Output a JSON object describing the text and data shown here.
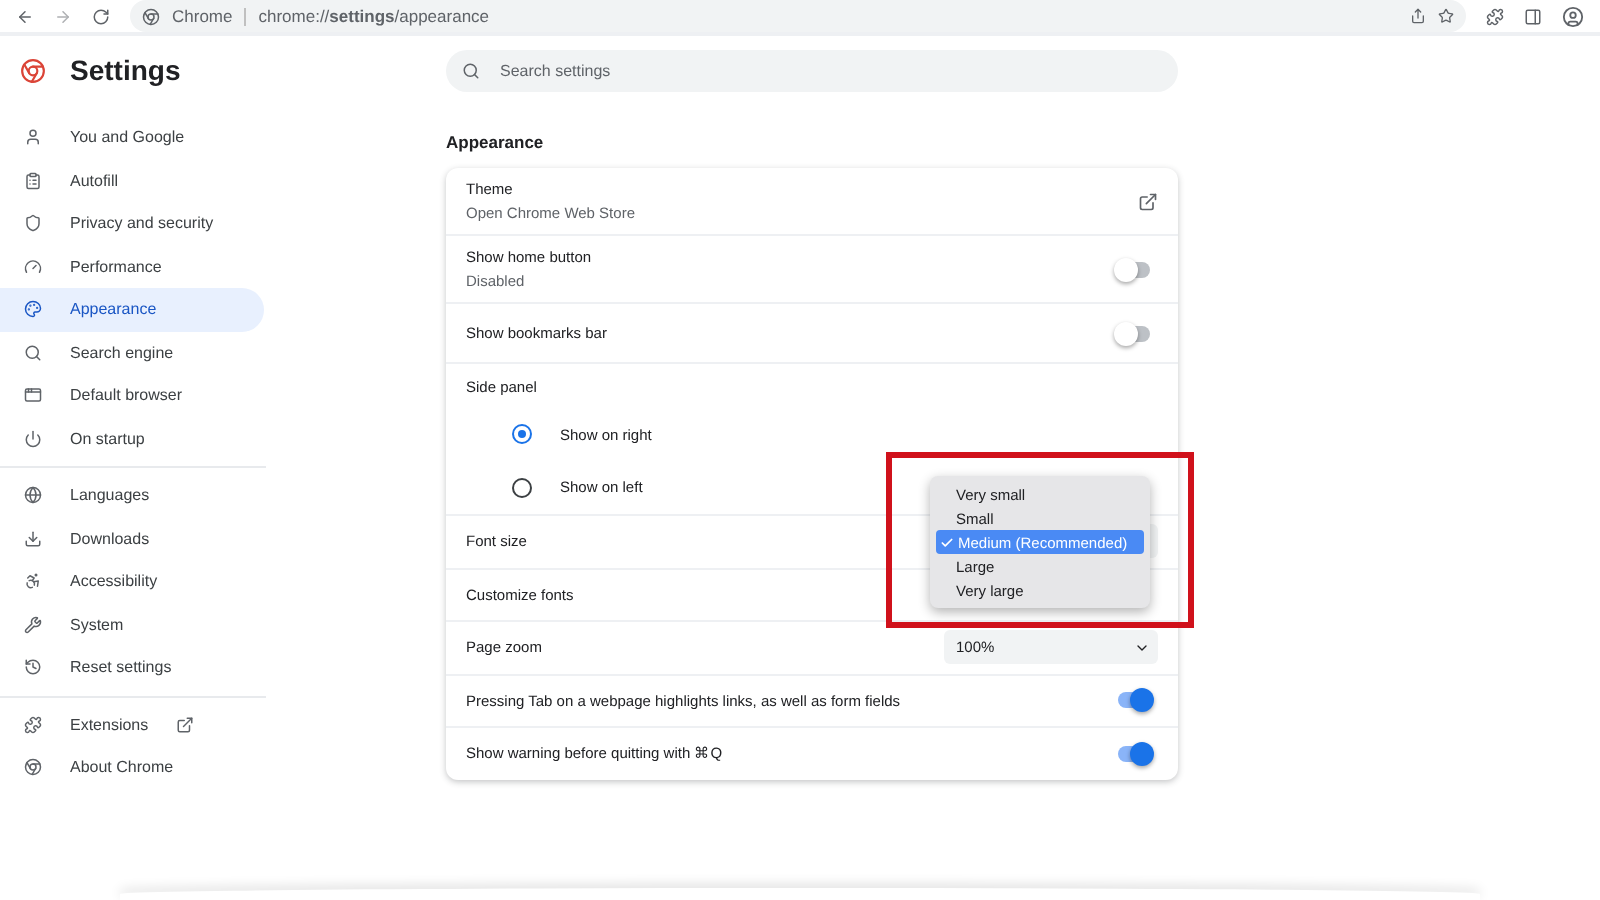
{
  "toolbar": {
    "site_label": "Chrome",
    "url": "chrome://**settings**/appearance"
  },
  "header": {
    "title": "Settings",
    "search": {
      "placeholder": "Search settings"
    }
  },
  "sidebar": {
    "groups": [
      [
        {
          "label": "You and Google",
          "selected": false
        },
        {
          "label": "Autofill",
          "selected": false
        },
        {
          "label": "Privacy and security",
          "selected": false
        },
        {
          "label": "Performance",
          "selected": false
        },
        {
          "label": "Appearance",
          "selected": true
        },
        {
          "label": "Search engine",
          "selected": false
        },
        {
          "label": "Default browser",
          "selected": false
        },
        {
          "label": "On startup",
          "selected": false
        }
      ],
      [
        {
          "label": "Languages",
          "selected": false
        },
        {
          "label": "Downloads",
          "selected": false
        },
        {
          "label": "Accessibility",
          "selected": false
        },
        {
          "label": "System",
          "selected": false
        },
        {
          "label": "Reset settings",
          "selected": false
        }
      ],
      [
        {
          "label": "Extensions",
          "selected": false
        },
        {
          "label": "About Chrome",
          "selected": false
        }
      ]
    ]
  },
  "section_title": "Appearance",
  "rows": [
    {
      "kind": "link",
      "label": "Theme",
      "sublabel": "Open Chrome Web Store"
    },
    {
      "kind": "toggle",
      "label": "Show home button",
      "sublabel": "Disabled",
      "on": false
    },
    {
      "kind": "toggle",
      "label": "Show bookmarks bar",
      "on": false
    },
    {
      "kind": "heading",
      "label": "Side panel"
    },
    {
      "kind": "radio",
      "label": "Show on right",
      "selected": true
    },
    {
      "kind": "radio",
      "label": "Show on left",
      "selected": false
    },
    {
      "kind": "select",
      "label": "Font size",
      "options": [
        {
          "label": "Very small",
          "selected": false
        },
        {
          "label": "Small",
          "selected": false
        },
        {
          "label": "Medium (Recommended)",
          "selected": true
        },
        {
          "label": "Large",
          "selected": false
        },
        {
          "label": "Very large",
          "selected": false
        }
      ]
    },
    {
      "kind": "plain",
      "label": "Customize fonts"
    },
    {
      "kind": "select",
      "label": "Page zoom",
      "value": "100%"
    },
    {
      "kind": "toggle",
      "label": "Pressing Tab on a webpage highlights links, as well as form fields",
      "on": true
    },
    {
      "kind": "toggle",
      "label": "Show warning before quitting with ⌘Q",
      "on": true
    }
  ]
}
